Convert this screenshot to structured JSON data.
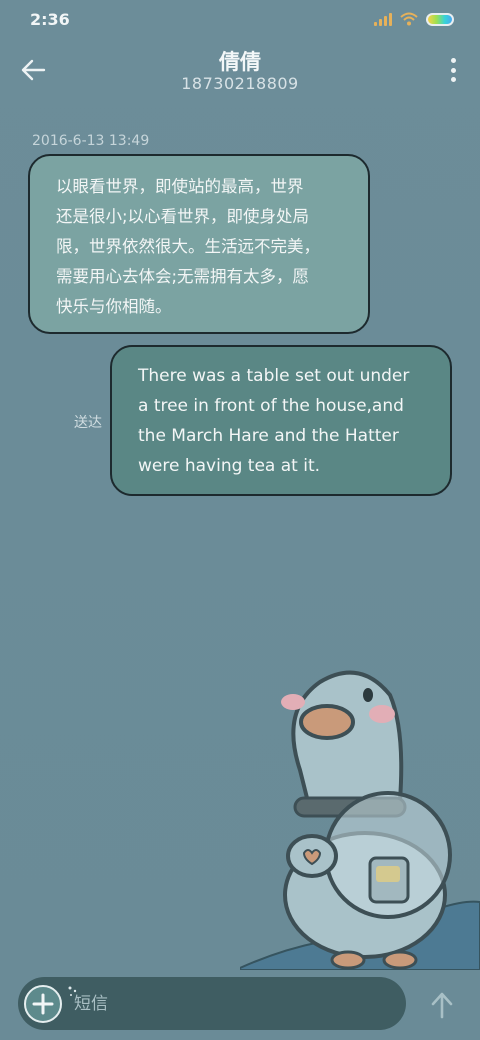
{
  "status_bar": {
    "time": "2:36"
  },
  "header": {
    "title": "倩倩",
    "phone_number": "18730218809"
  },
  "conversation": {
    "timestamp": "2016-6-13 13:49",
    "messages": [
      {
        "direction": "incoming",
        "lines": [
          "以眼看世界，即使站的最高，世界",
          "还是很小;以心看世界，即使身处局",
          "限，世界依然很大。生活远不完美，",
          "需要用心去体会;无需拥有太多，愿",
          "快乐与你相随。"
        ]
      },
      {
        "direction": "outgoing",
        "lines": [
          "There was a table set out under",
          "a tree in front of the house,and",
          "the March Hare and the Hatter",
          "were having tea at it."
        ],
        "status": "送达"
      }
    ]
  },
  "composer": {
    "placeholder": "短信"
  },
  "icons": {
    "back": "arrow-left-icon",
    "more": "more-vert-icon",
    "add": "plus-icon",
    "send": "arrow-up-icon"
  },
  "colors": {
    "background": "#6b8c98",
    "incoming_bubble": "#7ba3a2",
    "outgoing_bubble": "#5a8785",
    "input_bar": "#3f5d62"
  }
}
